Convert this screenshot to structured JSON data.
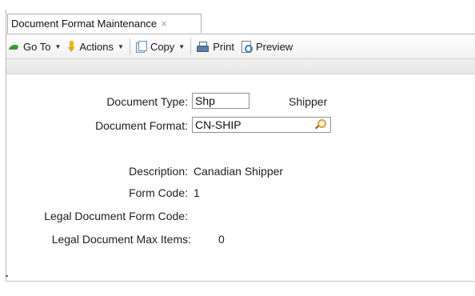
{
  "tab": {
    "title": "Document Format Maintenance",
    "close_glyph": "×"
  },
  "toolbar": {
    "goto_label": "Go To",
    "actions_label": "Actions",
    "copy_label": "Copy",
    "print_label": "Print",
    "preview_label": "Preview"
  },
  "form": {
    "document_type_label": "Document Type:",
    "document_type_value": "Shp",
    "document_type_description": "Shipper",
    "document_format_label": "Document Format:",
    "document_format_value": "CN-SHIP",
    "description_label": "Description:",
    "description_value": "Canadian Shipper",
    "form_code_label": "Form Code:",
    "form_code_value": "1",
    "legal_form_code_label": "Legal Document Form Code:",
    "legal_form_code_value": "",
    "legal_max_items_label": "Legal Document Max Items:",
    "legal_max_items_value": "0"
  }
}
